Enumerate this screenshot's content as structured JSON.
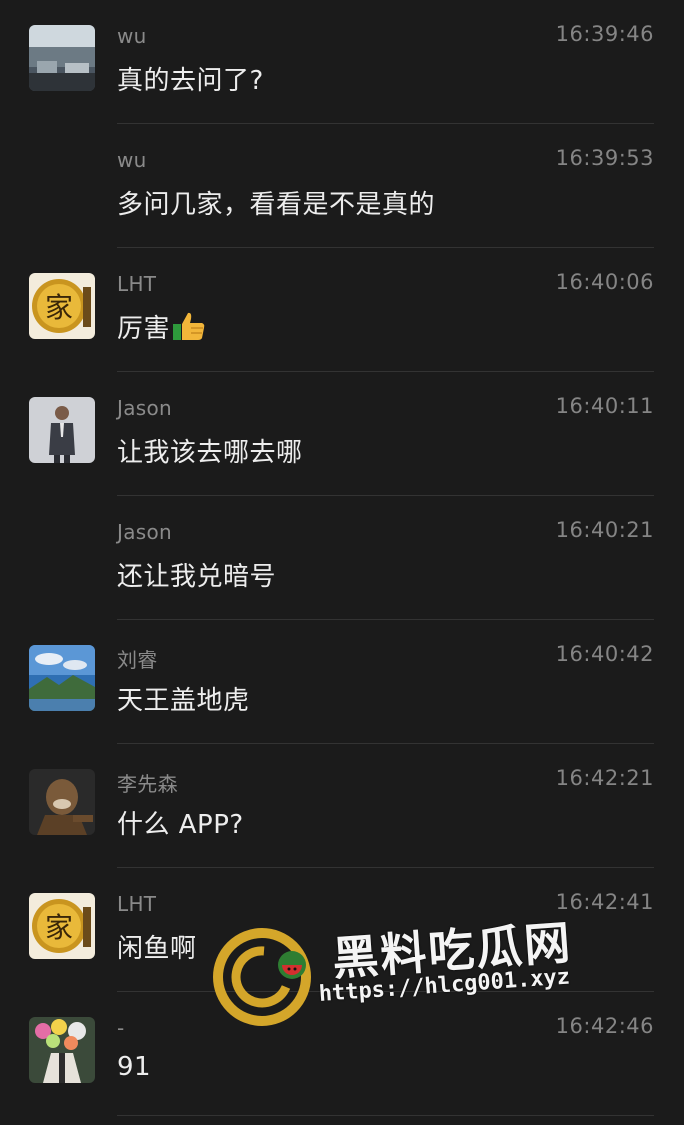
{
  "messages": [
    {
      "sender": "wu",
      "time": "16:39:46",
      "text": "真的去问了?",
      "avatar": "wu-photo-avatar"
    },
    {
      "sender": "wu",
      "time": "16:39:53",
      "text": "多问几家，看看是不是真的",
      "avatar": null
    },
    {
      "sender": "LHT",
      "time": "16:40:06",
      "text": "厉害",
      "emoji": "thumbs-up-icon",
      "avatar": "lht-seal-avatar"
    },
    {
      "sender": "Jason",
      "time": "16:40:11",
      "text": "让我该去哪去哪",
      "avatar": "jason-suit-avatar"
    },
    {
      "sender": "Jason",
      "time": "16:40:21",
      "text": "还让我兑暗号",
      "avatar": null
    },
    {
      "sender": "刘睿",
      "time": "16:40:42",
      "text": "天王盖地虎",
      "avatar": "liurui-landscape-avatar"
    },
    {
      "sender": "李先森",
      "time": "16:42:21",
      "text": "什么 APP?",
      "avatar": "lixiansen-statue-avatar"
    },
    {
      "sender": "LHT",
      "time": "16:42:41",
      "text": "闲鱼啊",
      "avatar": "lht-seal-avatar"
    },
    {
      "sender": "-",
      "time": "16:42:46",
      "text": "91",
      "avatar": "dash-flowers-avatar"
    }
  ],
  "watermark": {
    "title": "黑料吃瓜网",
    "url": "https://hlcg001.xyz",
    "logo_colors": {
      "ring": "#d4a62a",
      "accent": "#2e7d32",
      "fruit": "#d32f2f"
    }
  },
  "colors": {
    "background": "#1b1b1b",
    "text": "#ededed",
    "meta": "#8a8a8a",
    "divider": "#333333"
  }
}
